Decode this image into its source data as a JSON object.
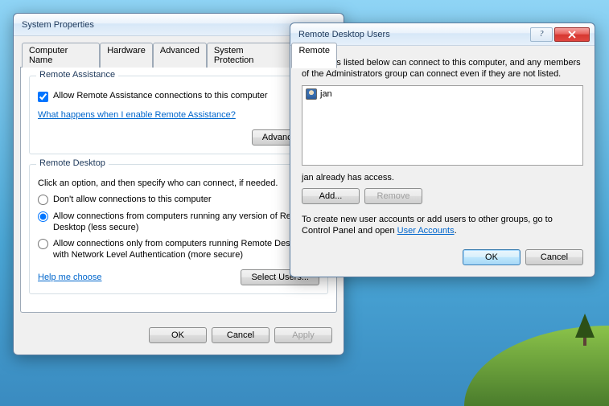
{
  "system_properties": {
    "title": "System Properties",
    "tabs": [
      "Computer Name",
      "Hardware",
      "Advanced",
      "System Protection",
      "Remote"
    ],
    "remote_assistance": {
      "group_title": "Remote Assistance",
      "allow_label": "Allow Remote Assistance connections to this computer",
      "allow_checked": true,
      "learn_link": "What happens when I enable Remote Assistance?",
      "advanced_button": "Advanced..."
    },
    "remote_desktop": {
      "group_title": "Remote Desktop",
      "instruction": "Click an option, and then specify who can connect, if needed.",
      "options": [
        "Don't allow connections to this computer",
        "Allow connections from computers running any version of Remote Desktop (less secure)",
        "Allow connections only from computers running Remote Desktop with Network Level Authentication (more secure)"
      ],
      "selected_index": 1,
      "help_link": "Help me choose",
      "select_users_button": "Select Users..."
    },
    "footer": {
      "ok": "OK",
      "cancel": "Cancel",
      "apply": "Apply"
    }
  },
  "rdu": {
    "title": "Remote Desktop Users",
    "instruction": "The users listed below can connect to this computer, and any members of the Administrators group can connect even if they are not listed.",
    "list": [
      "jan"
    ],
    "status": "jan already has access.",
    "add_button": "Add...",
    "remove_button": "Remove",
    "create_text_before": "To create new user accounts or add users to other groups, go to Control Panel and open ",
    "user_accounts_link": "User Accounts",
    "ok": "OK",
    "cancel": "Cancel"
  }
}
